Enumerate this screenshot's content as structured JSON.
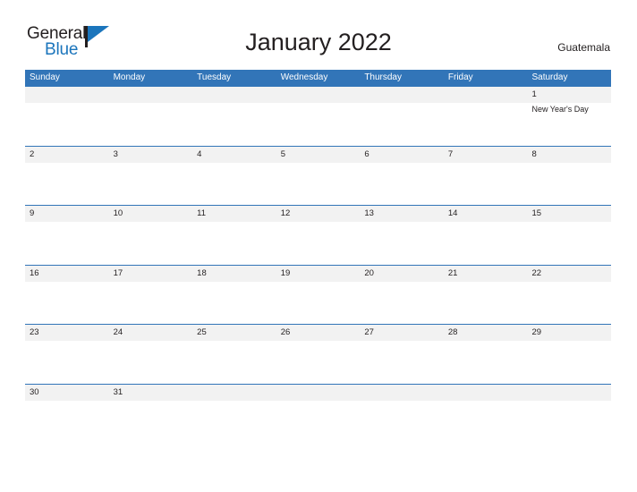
{
  "brand": {
    "name_part1": "General",
    "name_part2": "Blue"
  },
  "header": {
    "title": "January 2022",
    "country": "Guatemala"
  },
  "colors": {
    "header_blue": "#3275b8",
    "brand_blue": "#1b75bc",
    "band_gray": "#f2f2f2",
    "text_dark": "#231f20"
  },
  "calendar": {
    "weekdays": [
      "Sunday",
      "Monday",
      "Tuesday",
      "Wednesday",
      "Thursday",
      "Friday",
      "Saturday"
    ],
    "weeks": [
      [
        {
          "day": "",
          "event": ""
        },
        {
          "day": "",
          "event": ""
        },
        {
          "day": "",
          "event": ""
        },
        {
          "day": "",
          "event": ""
        },
        {
          "day": "",
          "event": ""
        },
        {
          "day": "",
          "event": ""
        },
        {
          "day": "1",
          "event": "New Year's Day"
        }
      ],
      [
        {
          "day": "2",
          "event": ""
        },
        {
          "day": "3",
          "event": ""
        },
        {
          "day": "4",
          "event": ""
        },
        {
          "day": "5",
          "event": ""
        },
        {
          "day": "6",
          "event": ""
        },
        {
          "day": "7",
          "event": ""
        },
        {
          "day": "8",
          "event": ""
        }
      ],
      [
        {
          "day": "9",
          "event": ""
        },
        {
          "day": "10",
          "event": ""
        },
        {
          "day": "11",
          "event": ""
        },
        {
          "day": "12",
          "event": ""
        },
        {
          "day": "13",
          "event": ""
        },
        {
          "day": "14",
          "event": ""
        },
        {
          "day": "15",
          "event": ""
        }
      ],
      [
        {
          "day": "16",
          "event": ""
        },
        {
          "day": "17",
          "event": ""
        },
        {
          "day": "18",
          "event": ""
        },
        {
          "day": "19",
          "event": ""
        },
        {
          "day": "20",
          "event": ""
        },
        {
          "day": "21",
          "event": ""
        },
        {
          "day": "22",
          "event": ""
        }
      ],
      [
        {
          "day": "23",
          "event": ""
        },
        {
          "day": "24",
          "event": ""
        },
        {
          "day": "25",
          "event": ""
        },
        {
          "day": "26",
          "event": ""
        },
        {
          "day": "27",
          "event": ""
        },
        {
          "day": "28",
          "event": ""
        },
        {
          "day": "29",
          "event": ""
        }
      ],
      [
        {
          "day": "30",
          "event": ""
        },
        {
          "day": "31",
          "event": ""
        },
        {
          "day": "",
          "event": ""
        },
        {
          "day": "",
          "event": ""
        },
        {
          "day": "",
          "event": ""
        },
        {
          "day": "",
          "event": ""
        },
        {
          "day": "",
          "event": ""
        }
      ]
    ]
  }
}
